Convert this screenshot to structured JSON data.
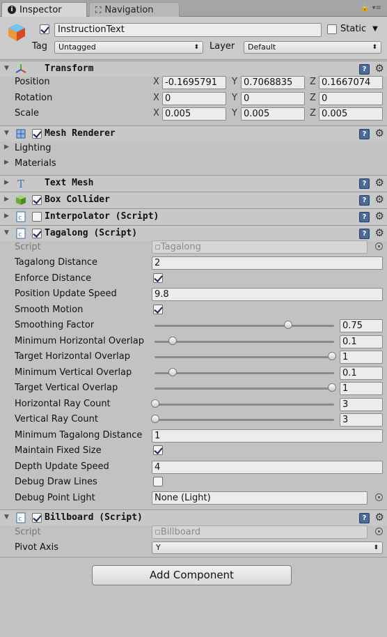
{
  "tabs": {
    "inspector": "Inspector",
    "navigation": "Navigation"
  },
  "header": {
    "name": "InstructionText",
    "static_label": "Static",
    "tag_label": "Tag",
    "tag_value": "Untagged",
    "layer_label": "Layer",
    "layer_value": "Default"
  },
  "transform": {
    "title": "Transform",
    "position_label": "Position",
    "rotation_label": "Rotation",
    "scale_label": "Scale",
    "axis_x": "X",
    "axis_y": "Y",
    "axis_z": "Z",
    "position": {
      "x": "-0.1695791",
      "y": "0.7068835",
      "z": "0.1667074"
    },
    "rotation": {
      "x": "0",
      "y": "0",
      "z": "0"
    },
    "scale": {
      "x": "0.005",
      "y": "0.005",
      "z": "0.005"
    }
  },
  "mesh_renderer": {
    "title": "Mesh Renderer",
    "lighting": "Lighting",
    "materials": "Materials"
  },
  "text_mesh": {
    "title": "Text Mesh"
  },
  "box_collider": {
    "title": "Box Collider"
  },
  "interpolator": {
    "title": "Interpolator (Script)"
  },
  "tagalong": {
    "title": "Tagalong (Script)",
    "script_label": "Script",
    "script_value": "Tagalong",
    "tagalong_distance_label": "Tagalong Distance",
    "tagalong_distance": "2",
    "enforce_distance_label": "Enforce Distance",
    "position_update_speed_label": "Position Update Speed",
    "position_update_speed": "9.8",
    "smooth_motion_label": "Smooth Motion",
    "smoothing_factor_label": "Smoothing Factor",
    "smoothing_factor": "0.75",
    "smoothing_factor_fraction": 0.75,
    "min_h_overlap_label": "Minimum Horizontal Overlap",
    "min_h_overlap": "0.1",
    "min_h_overlap_fraction": 0.1,
    "target_h_overlap_label": "Target Horizontal Overlap",
    "target_h_overlap": "1",
    "target_h_overlap_fraction": 1.0,
    "min_v_overlap_label": "Minimum Vertical Overlap",
    "min_v_overlap": "0.1",
    "min_v_overlap_fraction": 0.1,
    "target_v_overlap_label": "Target Vertical Overlap",
    "target_v_overlap": "1",
    "target_v_overlap_fraction": 1.0,
    "h_ray_count_label": "Horizontal Ray Count",
    "h_ray_count": "3",
    "h_ray_count_fraction": 0.0,
    "v_ray_count_label": "Vertical Ray Count",
    "v_ray_count": "3",
    "v_ray_count_fraction": 0.0,
    "min_tagalong_distance_label": "Minimum Tagalong Distance",
    "min_tagalong_distance": "1",
    "maintain_fixed_size_label": "Maintain Fixed Size",
    "depth_update_speed_label": "Depth Update Speed",
    "depth_update_speed": "4",
    "debug_draw_lines_label": "Debug Draw Lines",
    "debug_point_light_label": "Debug Point Light",
    "debug_point_light": "None (Light)"
  },
  "billboard": {
    "title": "Billboard (Script)",
    "script_label": "Script",
    "script_value": "Billboard",
    "pivot_axis_label": "Pivot Axis",
    "pivot_axis": "Y"
  },
  "add_component_label": "Add Component"
}
